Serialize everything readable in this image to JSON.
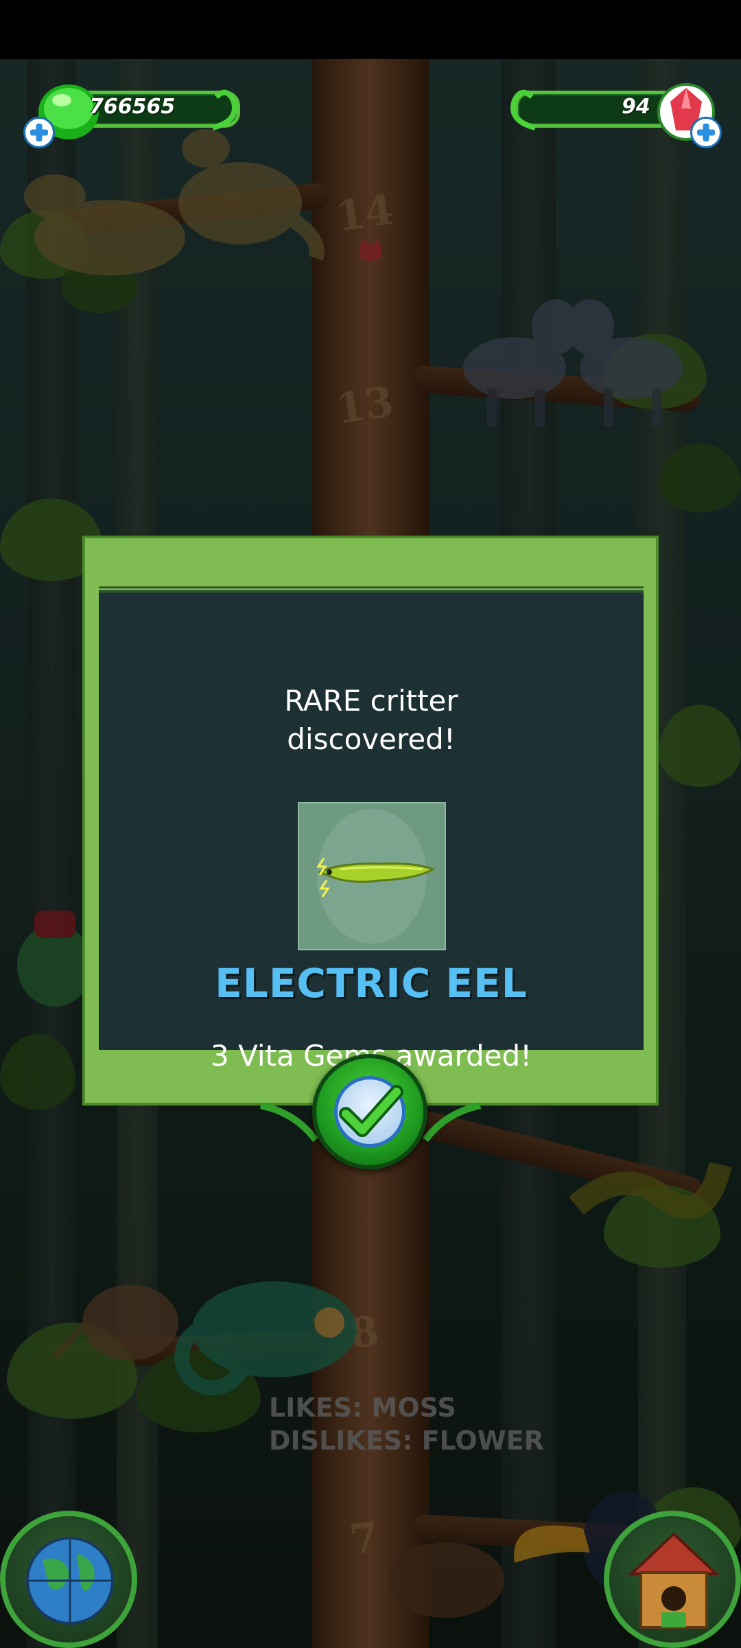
{
  "hud": {
    "currency_value": "766565",
    "gems_value": "94"
  },
  "tree": {
    "level_numbers": [
      "14",
      "13",
      "8",
      "7"
    ],
    "critter_preference": {
      "likes": "LIKES: MOSS",
      "dislikes": "DISLIKES: FLOWER"
    }
  },
  "dialog": {
    "title_line1": "RARE critter",
    "title_line2": "discovered!",
    "critter_name": "ELECTRIC EEL",
    "award_text": "3 Vita Gems awarded!",
    "critter_icon": "electric-eel"
  },
  "buttons": {
    "confirm_icon": "checkmark-icon",
    "left_corner_icon": "globe-icon",
    "right_corner_icon": "birdhouse-icon"
  },
  "colors": {
    "dialog_frame": "#7fbd52",
    "dialog_panel": "#1d3033",
    "critter_name": "#56bff3",
    "hud_green": "#57c23c",
    "gem_red": "#e23a4a"
  }
}
